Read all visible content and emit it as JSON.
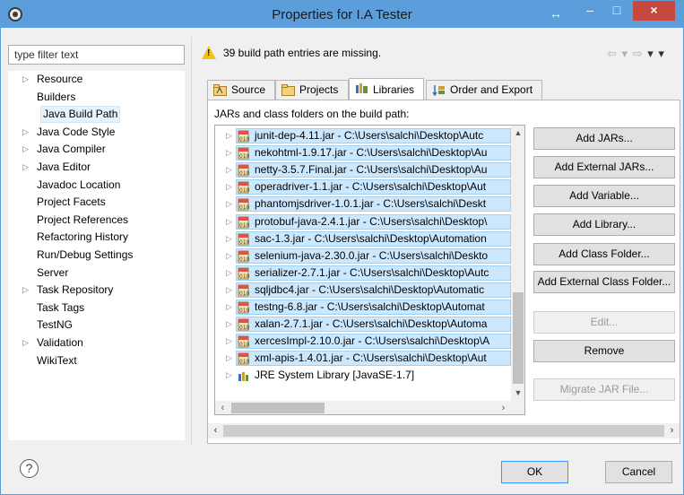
{
  "window": {
    "title": "Properties for I.A Tester",
    "resize_glyph": "↔",
    "minimize": "–",
    "maximize": "□",
    "close": "×"
  },
  "filter": {
    "placeholder": "type filter text"
  },
  "nav": {
    "items": [
      {
        "label": "Resource",
        "arrow": "▷"
      },
      {
        "label": "Builders",
        "arrow": ""
      },
      {
        "label": "Java Build Path",
        "arrow": "",
        "selected": true
      },
      {
        "label": "Java Code Style",
        "arrow": "▷"
      },
      {
        "label": "Java Compiler",
        "arrow": "▷"
      },
      {
        "label": "Java Editor",
        "arrow": "▷"
      },
      {
        "label": "Javadoc Location",
        "arrow": ""
      },
      {
        "label": "Project Facets",
        "arrow": ""
      },
      {
        "label": "Project References",
        "arrow": ""
      },
      {
        "label": "Refactoring History",
        "arrow": ""
      },
      {
        "label": "Run/Debug Settings",
        "arrow": ""
      },
      {
        "label": "Server",
        "arrow": ""
      },
      {
        "label": "Task Repository",
        "arrow": "▷"
      },
      {
        "label": "Task Tags",
        "arrow": ""
      },
      {
        "label": "TestNG",
        "arrow": ""
      },
      {
        "label": "Validation",
        "arrow": "▷"
      },
      {
        "label": "WikiText",
        "arrow": ""
      }
    ]
  },
  "header": {
    "warning_text": "39 build path entries are missing.",
    "back_arrow": "⇦",
    "fwd_arrow": "⇨",
    "menu_arrow": "▾"
  },
  "tabs": [
    {
      "label": "Source"
    },
    {
      "label": "Projects"
    },
    {
      "label": "Libraries"
    },
    {
      "label": "Order and Export"
    }
  ],
  "libraries": {
    "label": "JARs and class folders on the build path:",
    "entries": [
      {
        "text": "junit-dep-4.11.jar - C:\\Users\\salchi\\Desktop\\Autc",
        "selected": true,
        "kind": "jar"
      },
      {
        "text": "nekohtml-1.9.17.jar - C:\\Users\\salchi\\Desktop\\Au",
        "selected": true,
        "kind": "jar"
      },
      {
        "text": "netty-3.5.7.Final.jar - C:\\Users\\salchi\\Desktop\\Au",
        "selected": true,
        "kind": "jar"
      },
      {
        "text": "operadriver-1.1.jar - C:\\Users\\salchi\\Desktop\\Aut",
        "selected": true,
        "kind": "jar"
      },
      {
        "text": "phantomjsdriver-1.0.1.jar - C:\\Users\\salchi\\Deskt",
        "selected": true,
        "kind": "jar"
      },
      {
        "text": "protobuf-java-2.4.1.jar - C:\\Users\\salchi\\Desktop\\",
        "selected": true,
        "kind": "jar"
      },
      {
        "text": "sac-1.3.jar - C:\\Users\\salchi\\Desktop\\Automation",
        "selected": true,
        "kind": "jar"
      },
      {
        "text": "selenium-java-2.30.0.jar - C:\\Users\\salchi\\Deskto",
        "selected": true,
        "kind": "jar"
      },
      {
        "text": "serializer-2.7.1.jar - C:\\Users\\salchi\\Desktop\\Autc",
        "selected": true,
        "kind": "jar"
      },
      {
        "text": "sqljdbc4.jar - C:\\Users\\salchi\\Desktop\\Automatic",
        "selected": true,
        "kind": "jar"
      },
      {
        "text": "testng-6.8.jar - C:\\Users\\salchi\\Desktop\\Automat",
        "selected": true,
        "kind": "jar"
      },
      {
        "text": "xalan-2.7.1.jar - C:\\Users\\salchi\\Desktop\\Automa",
        "selected": true,
        "kind": "jar"
      },
      {
        "text": "xercesImpl-2.10.0.jar - C:\\Users\\salchi\\Desktop\\A",
        "selected": true,
        "kind": "jar"
      },
      {
        "text": "xml-apis-1.4.01.jar - C:\\Users\\salchi\\Desktop\\Aut",
        "selected": true,
        "kind": "jar"
      },
      {
        "text": "JRE System Library [JavaSE-1.7]",
        "selected": false,
        "kind": "library"
      }
    ]
  },
  "buttons": {
    "add_jars": "Add JARs...",
    "add_external_jars": "Add External JARs...",
    "add_variable": "Add Variable...",
    "add_library": "Add Library...",
    "add_class_folder": "Add Class Folder...",
    "add_external_class_folder": "Add External Class Folder...",
    "edit": "Edit...",
    "remove": "Remove",
    "migrate_jar": "Migrate JAR File..."
  },
  "footer": {
    "help": "?",
    "ok": "OK",
    "cancel": "Cancel"
  },
  "colors": {
    "titlebar": "#5c9edb",
    "close": "#c7483e",
    "selection": "#cce8ff",
    "warning": "#f2c21b"
  }
}
